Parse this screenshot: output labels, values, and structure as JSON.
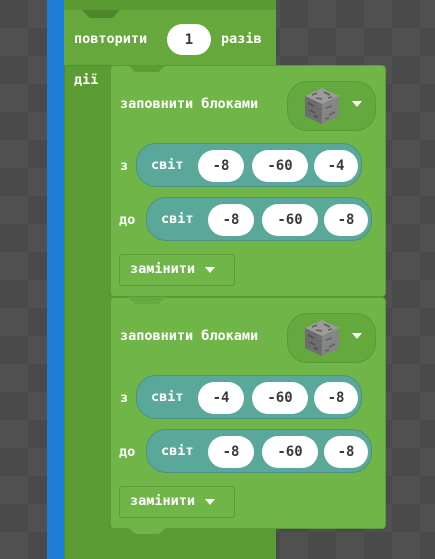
{
  "repeat": {
    "label_before": "повторити",
    "count": "1",
    "label_after": "разів",
    "do_label": "дії"
  },
  "blocks": [
    {
      "title": "заповнити блоками",
      "block_icon": "cobblestone-icon",
      "from_label": "з",
      "from_world": "світ",
      "from": [
        "-8",
        "-60",
        "-4"
      ],
      "to_label": "до",
      "to_world": "світ",
      "to": [
        "-8",
        "-60",
        "-8"
      ],
      "mode": "замінити"
    },
    {
      "title": "заповнити блоками",
      "block_icon": "cobblestone-icon",
      "from_label": "з",
      "from_world": "світ",
      "from": [
        "-4",
        "-60",
        "-8"
      ],
      "to_label": "до",
      "to_world": "світ",
      "to": [
        "-8",
        "-60",
        "-8"
      ],
      "mode": "замінити"
    }
  ],
  "colors": {
    "background": "#4a4a4a",
    "loop_block": "#5b9c34",
    "fill_block": "#70b548",
    "world_pill": "#5aa89a",
    "stack_stripe": "#1e7ed6"
  }
}
